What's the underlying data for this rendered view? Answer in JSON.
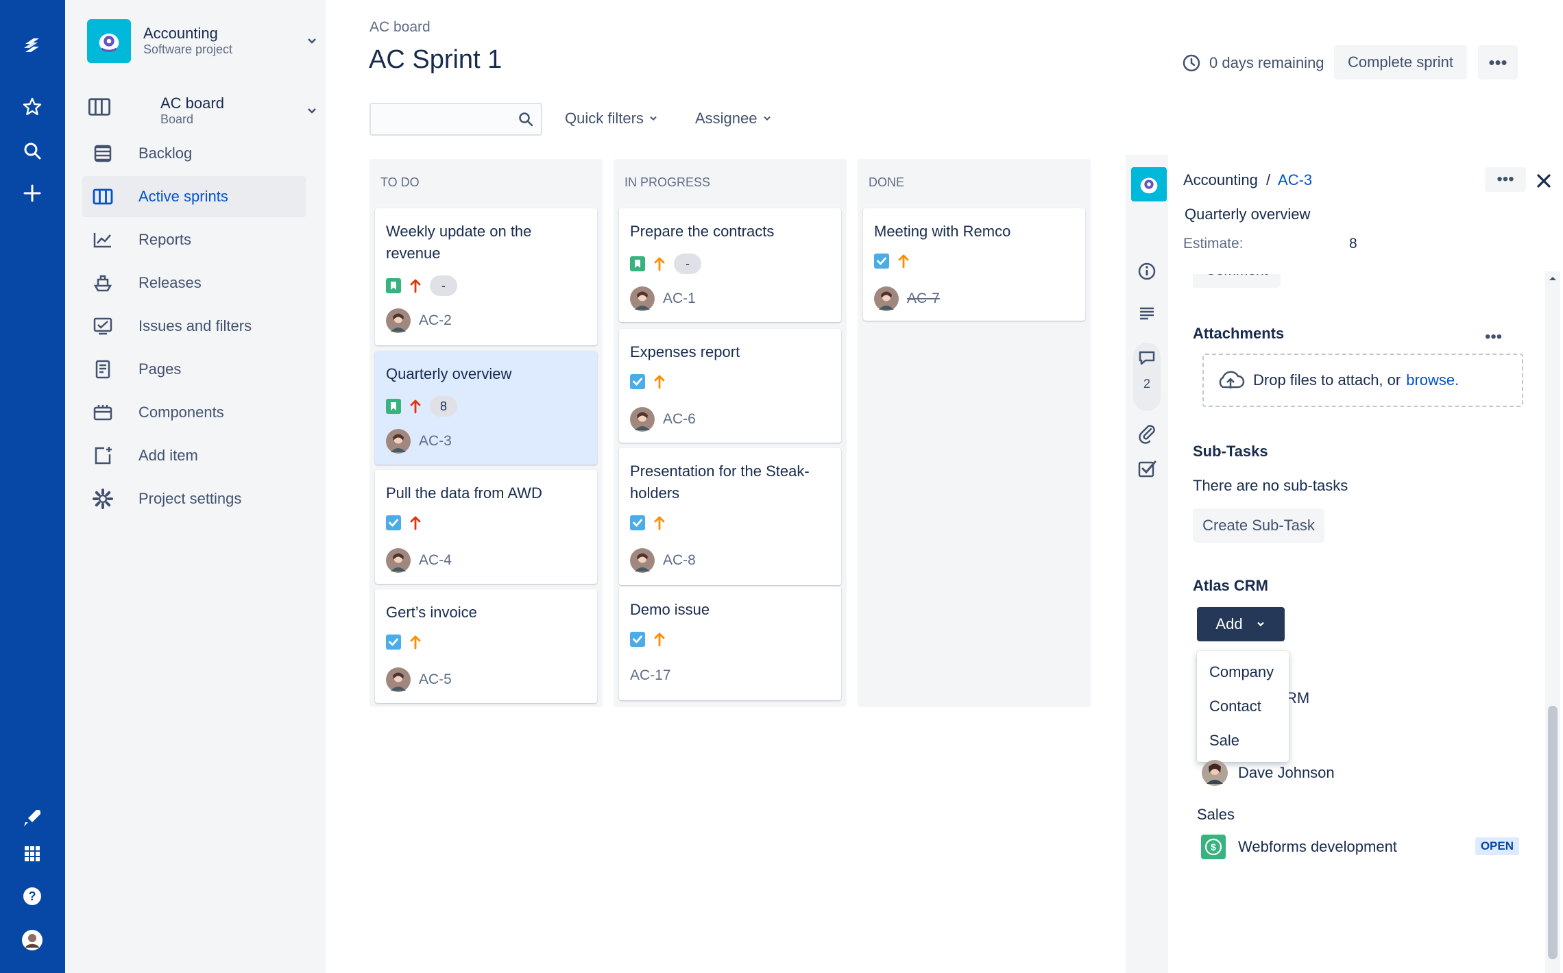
{
  "project": {
    "name": "Accounting",
    "type": "Software project"
  },
  "board": {
    "name": "AC board",
    "type": "Board"
  },
  "nav": [
    {
      "label": "Backlog",
      "icon": "backlog-icon",
      "active": false
    },
    {
      "label": "Active sprints",
      "icon": "board-columns-icon",
      "active": true
    },
    {
      "label": "Reports",
      "icon": "chart-icon",
      "active": false
    },
    {
      "label": "Releases",
      "icon": "ship-icon",
      "active": false
    },
    {
      "label": "Issues and filters",
      "icon": "issues-icon",
      "active": false
    },
    {
      "label": "Pages",
      "icon": "page-icon",
      "active": false
    },
    {
      "label": "Components",
      "icon": "component-icon",
      "active": false
    },
    {
      "label": "Add item",
      "icon": "add-item-icon",
      "active": false
    },
    {
      "label": "Project settings",
      "icon": "gear-icon",
      "active": false
    }
  ],
  "header": {
    "breadcrumb": "AC board",
    "title": "AC Sprint 1",
    "remaining": "0 days remaining",
    "complete_label": "Complete sprint",
    "more_label": "•••"
  },
  "filters": {
    "search_placeholder": "",
    "quick": "Quick filters",
    "assignee": "Assignee"
  },
  "columns": [
    {
      "title": "TO DO",
      "cards": [
        {
          "title": "Weekly update on the revenue",
          "type": "story",
          "priority": "highest",
          "estimate": "-",
          "key": "AC-2",
          "selected": false
        },
        {
          "title": "Quarterly overview",
          "type": "story",
          "priority": "highest",
          "estimate": "8",
          "key": "AC-3",
          "selected": true
        },
        {
          "title": "Pull the data from AWD",
          "type": "task",
          "priority": "highest",
          "estimate": "",
          "key": "AC-4",
          "selected": false
        },
        {
          "title": "Gert’s invoice",
          "type": "task",
          "priority": "medium",
          "estimate": "",
          "key": "AC-5",
          "selected": false
        }
      ]
    },
    {
      "title": "IN PROGRESS",
      "cards": [
        {
          "title": "Prepare the contracts",
          "type": "story",
          "priority": "medium",
          "estimate": "-",
          "key": "AC-1",
          "selected": false
        },
        {
          "title": "Expenses report",
          "type": "task",
          "priority": "medium",
          "estimate": "",
          "key": "AC-6",
          "selected": false
        },
        {
          "title": "Presentation for the Steak-holders",
          "type": "task",
          "priority": "medium",
          "estimate": "",
          "key": "AC-8",
          "selected": false
        },
        {
          "title": "Demo issue",
          "type": "task",
          "priority": "medium",
          "estimate": "",
          "key": "AC-17",
          "selected": false
        }
      ]
    },
    {
      "title": "DONE",
      "cards": [
        {
          "title": "Meeting with Remco",
          "type": "task",
          "priority": "medium",
          "estimate": "",
          "key": "AC-7",
          "selected": false
        }
      ]
    }
  ],
  "detail": {
    "project": "Accounting",
    "separator": "/",
    "key": "AC-3",
    "summary": "Quarterly overview",
    "estimate_label": "Estimate:",
    "estimate_value": "8",
    "comment_label": "Comment",
    "comment_count": "2",
    "attachments_title": "Attachments",
    "drop_text": "Drop files to attach, or",
    "browse": "browse.",
    "subtasks_title": "Sub-Tasks",
    "no_subtasks": "There are no sub-tasks",
    "create_subtask": "Create Sub-Task",
    "crm_title": "Atlas CRM",
    "add_label": "Add",
    "dropdown": [
      "Company",
      "Contact",
      "Sale"
    ],
    "hidden_text": "RM",
    "contact_name": "Dave Johnson",
    "sales_label": "Sales",
    "sale_name": "Webforms development",
    "sale_status": "OPEN"
  },
  "colors": {
    "nav": "#0747a6",
    "link": "#0052cc",
    "story": "#36b37e",
    "task": "#4bade8",
    "highest": "#de350b",
    "medium": "#ff8b00"
  }
}
